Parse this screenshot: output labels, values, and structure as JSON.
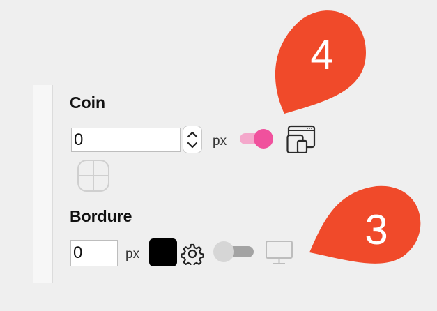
{
  "colors": {
    "background": "#efefef",
    "accent": "#f0519d",
    "accent_light": "#f4a8cb",
    "marker": "#f04a2a",
    "border_swatch": "#000000"
  },
  "corner": {
    "title": "Coin",
    "value": "0",
    "unit": "px",
    "responsive_toggle_on": true,
    "device_icon": "responsive-devices-icon",
    "corner_picker_icon": "corner-split-icon"
  },
  "border": {
    "title": "Bordure",
    "value": "0",
    "unit": "px",
    "color": "#000000",
    "settings_icon": "gear-icon",
    "responsive_toggle_on": false,
    "device_icon": "desktop-icon"
  },
  "markers": [
    {
      "label": "4"
    },
    {
      "label": "3"
    }
  ]
}
